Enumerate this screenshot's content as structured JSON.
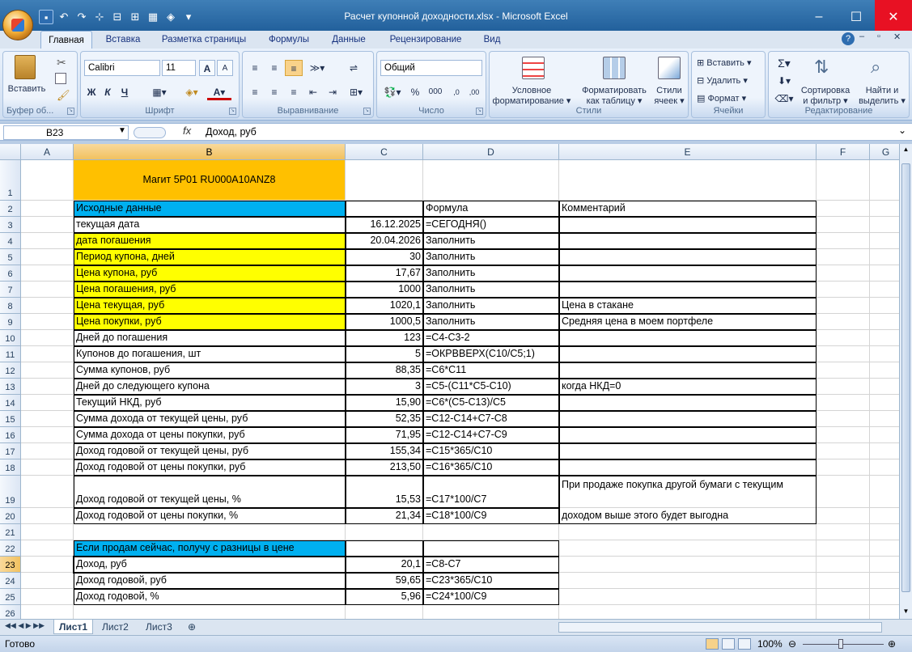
{
  "window": {
    "title": "Расчет купонной доходности.xlsx - Microsoft Excel",
    "min": "–",
    "max": "☐",
    "close": "✕"
  },
  "ribbon_tabs": [
    "Главная",
    "Вставка",
    "Разметка страницы",
    "Формулы",
    "Данные",
    "Рецензирование",
    "Вид"
  ],
  "ribbon": {
    "clipboard": {
      "paste": "Вставить",
      "label": "Буфер об..."
    },
    "font": {
      "name": "Calibri",
      "size": "11",
      "bold": "Ж",
      "italic": "К",
      "underline": "Ч",
      "label": "Шрифт"
    },
    "alignment": {
      "label": "Выравнивание"
    },
    "number": {
      "format": "Общий",
      "label": "Число",
      "percent": "%",
      "thousands": "000"
    },
    "styles": {
      "conditional": "Условное",
      "conditional2": "форматирование ▾",
      "astable": "Форматировать",
      "astable2": "как таблицу ▾",
      "cellstyles": "Стили",
      "cellstyles2": "ячеек ▾",
      "label": "Стили"
    },
    "cells": {
      "insert": "Вставить ▾",
      "delete": "Удалить ▾",
      "format": "Формат ▾",
      "label": "Ячейки"
    },
    "editing": {
      "sort": "Сортировка",
      "sort2": "и фильтр ▾",
      "find": "Найти и",
      "find2": "выделить ▾",
      "label": "Редактирование"
    }
  },
  "formula_bar": {
    "name_box": "B23",
    "fx": "fx",
    "content": "Доход, руб"
  },
  "columns": [
    "A",
    "B",
    "C",
    "D",
    "E",
    "F",
    "G"
  ],
  "rows": [
    {
      "n": "1",
      "B": "Магит 5P01  RU000A10ANZ8"
    },
    {
      "n": "2",
      "B": "Исходные данные",
      "C": "",
      "D": "Формула",
      "E": "Комментарий"
    },
    {
      "n": "3",
      "B": "текущая дата",
      "C": "16.12.2025",
      "D": "=СЕГОДНЯ()",
      "E": ""
    },
    {
      "n": "4",
      "B": "дата погашения",
      "C": "20.04.2026",
      "D": "Заполнить",
      "E": ""
    },
    {
      "n": "5",
      "B": "Период купона, дней",
      "C": "30",
      "D": "Заполнить",
      "E": ""
    },
    {
      "n": "6",
      "B": "Цена купона, руб",
      "C": "17,67",
      "D": "Заполнить",
      "E": ""
    },
    {
      "n": "7",
      "B": "Цена погашения, руб",
      "C": "1000",
      "D": "Заполнить",
      "E": ""
    },
    {
      "n": "8",
      "B": "Цена текущая, руб",
      "C": "1020,1",
      "D": "Заполнить",
      "E": "Цена в стакане"
    },
    {
      "n": "9",
      "B": "Цена покупки, руб",
      "C": "1000,5",
      "D": "Заполнить",
      "E": "Средняя цена в моем портфеле"
    },
    {
      "n": "10",
      "B": "Дней до погашения",
      "C": "123",
      "D": "=C4-C3-2",
      "E": ""
    },
    {
      "n": "11",
      "B": "Купонов до погашения, шт",
      "C": "5",
      "D": "=ОКРВВЕРХ(C10/C5;1)",
      "E": ""
    },
    {
      "n": "12",
      "B": "Сумма купонов, руб",
      "C": "88,35",
      "D": "=C6*C11",
      "E": ""
    },
    {
      "n": "13",
      "B": "Дней до следующего купона",
      "C": "3",
      "D": "=C5-(C11*C5-C10)",
      "E": "когда НКД=0"
    },
    {
      "n": "14",
      "B": "Текущий НКД, руб",
      "C": "15,90",
      "D": "=C6*(C5-C13)/C5",
      "E": ""
    },
    {
      "n": "15",
      "B": "Сумма дохода от текущей цены, руб",
      "C": "52,35",
      "D": "=C12-C14+C7-C8",
      "E": ""
    },
    {
      "n": "16",
      "B": "Сумма дохода от цены покупки, руб",
      "C": "71,95",
      "D": "=C12-C14+C7-C9",
      "E": ""
    },
    {
      "n": "17",
      "B": "Доход годовой от текущей цены, руб",
      "C": "155,34",
      "D": "=C15*365/C10",
      "E": ""
    },
    {
      "n": "18",
      "B": "Доход годовой от цены покупки, руб",
      "C": "213,50",
      "D": "=C16*365/C10",
      "E": ""
    },
    {
      "n": "19",
      "B": "Доход годовой от текущей цены, %",
      "C": "15,53",
      "D": "=C17*100/C7",
      "E": "При продаже покупка другой бумаги с текущим"
    },
    {
      "n": "20",
      "B": "Доход годовой от цены покупки, %",
      "C": "21,34",
      "D": "=C18*100/C9",
      "E": "доходом выше этого будет выгодна"
    },
    {
      "n": "21"
    },
    {
      "n": "22",
      "B": "Если продам сейчас, получу с разницы в цене",
      "C": "",
      "D": ""
    },
    {
      "n": "23",
      "B": "Доход, руб",
      "C": "20,1",
      "D": "=C8-C7"
    },
    {
      "n": "24",
      "B": "Доход годовой, руб",
      "C": "59,65",
      "D": "=C23*365/C10"
    },
    {
      "n": "25",
      "B": "Доход годовой, %",
      "C": "5,96",
      "D": "=C24*100/C9"
    },
    {
      "n": "26"
    }
  ],
  "sheets": [
    "Лист1",
    "Лист2",
    "Лист3"
  ],
  "status": {
    "ready": "Готово",
    "zoom": "100%"
  },
  "colors": {
    "orange": "#ffc000",
    "blue": "#00b0f0",
    "yellow": "#ffff00",
    "title_bar": "#1f5d99"
  }
}
